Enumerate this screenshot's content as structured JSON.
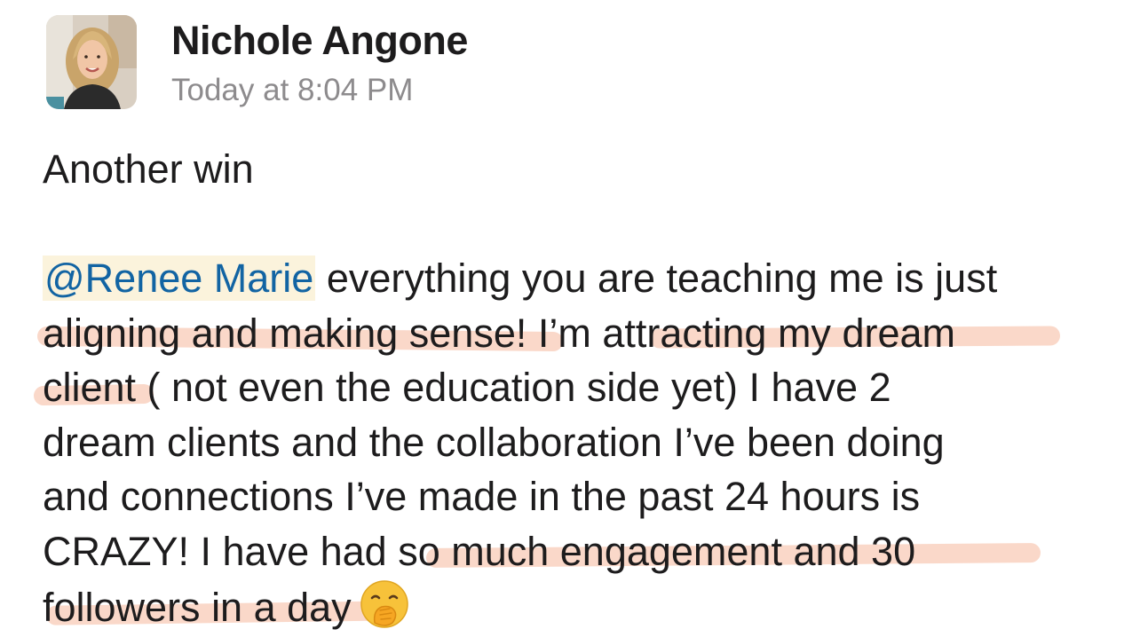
{
  "author": {
    "name": "Nichole Angone",
    "timestamp": "Today at 8:04 PM",
    "avatar_icon": "user-avatar-photo"
  },
  "message": {
    "first_line": "Another win",
    "mention": "@Renee Marie",
    "lines": [
      " everything you are teaching me is just",
      "aligning and making sense! I’m attracting my dream",
      "client ( not even the education side yet) I have 2",
      "dream clients and the collaboration I’ve been doing",
      "and connections I’ve made in the past 24 hours is",
      "CRAZY! I have had so much engagement and 30",
      "followers in a day"
    ],
    "emoji_icon": "face-with-hand-over-mouth-icon"
  },
  "colors": {
    "mention_text": "#1264a3",
    "mention_bg": "#fbf3dc",
    "highlight": "#f6b89c",
    "timestamp": "#8d8b8d"
  }
}
